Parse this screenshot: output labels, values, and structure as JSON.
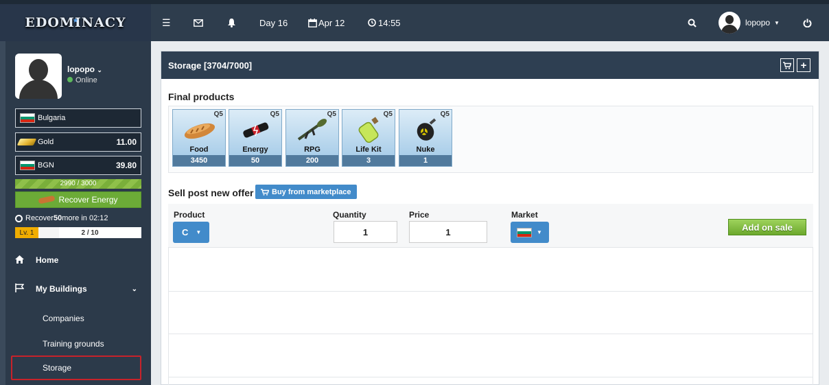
{
  "app": {
    "logo_text": "EDOMINACY"
  },
  "topbar": {
    "day": "Day 16",
    "date": "Apr 12",
    "time": "14:55",
    "username": "lopopo"
  },
  "profile": {
    "name": "lopopo",
    "status": "Online"
  },
  "citizenship": {
    "country": "Bulgaria"
  },
  "currencies": [
    {
      "name": "Gold",
      "value": "11.00"
    },
    {
      "name": "BGN",
      "value": "39.80"
    }
  ],
  "energy": {
    "current_total": "2990 / 3000",
    "recover_label": "Recover Energy",
    "recover_prefix": "Recover ",
    "recover_amount": "50",
    "recover_suffix": " more in 02:12"
  },
  "level": {
    "label": "Lv. 1",
    "xp": "2 / 10"
  },
  "nav": {
    "home": "Home",
    "my_buildings": "My Buildings",
    "companies": "Companies",
    "training_grounds": "Training grounds",
    "storage": "Storage"
  },
  "storage": {
    "title": "Storage [3704/7000]",
    "final_products_title": "Final products",
    "products": [
      {
        "name": "Food",
        "quality": "Q5",
        "count": "3450",
        "icon": "food-icon"
      },
      {
        "name": "Energy",
        "quality": "Q5",
        "count": "50",
        "icon": "energy-icon"
      },
      {
        "name": "RPG",
        "quality": "Q5",
        "count": "200",
        "icon": "rpg-icon"
      },
      {
        "name": "Life Kit",
        "quality": "Q5",
        "count": "3",
        "icon": "life-kit-icon"
      },
      {
        "name": "Nuke",
        "quality": "Q5",
        "count": "1",
        "icon": "nuke-icon"
      }
    ]
  },
  "sell": {
    "title": "Sell post new offer",
    "buy_marketplace_label": "Buy from marketplace",
    "product_label": "Product",
    "quantity_label": "Quantity",
    "price_label": "Price",
    "market_label": "Market",
    "quantity_value": "1",
    "price_value": "1",
    "add_on_sale_label": "Add on sale"
  },
  "colors": {
    "topbar": "#2e3d4d",
    "sidebar": "#2c3a4a",
    "accent_blue": "#428bca",
    "energy_green": "#6cab37",
    "highlight_red": "#c8222a"
  }
}
